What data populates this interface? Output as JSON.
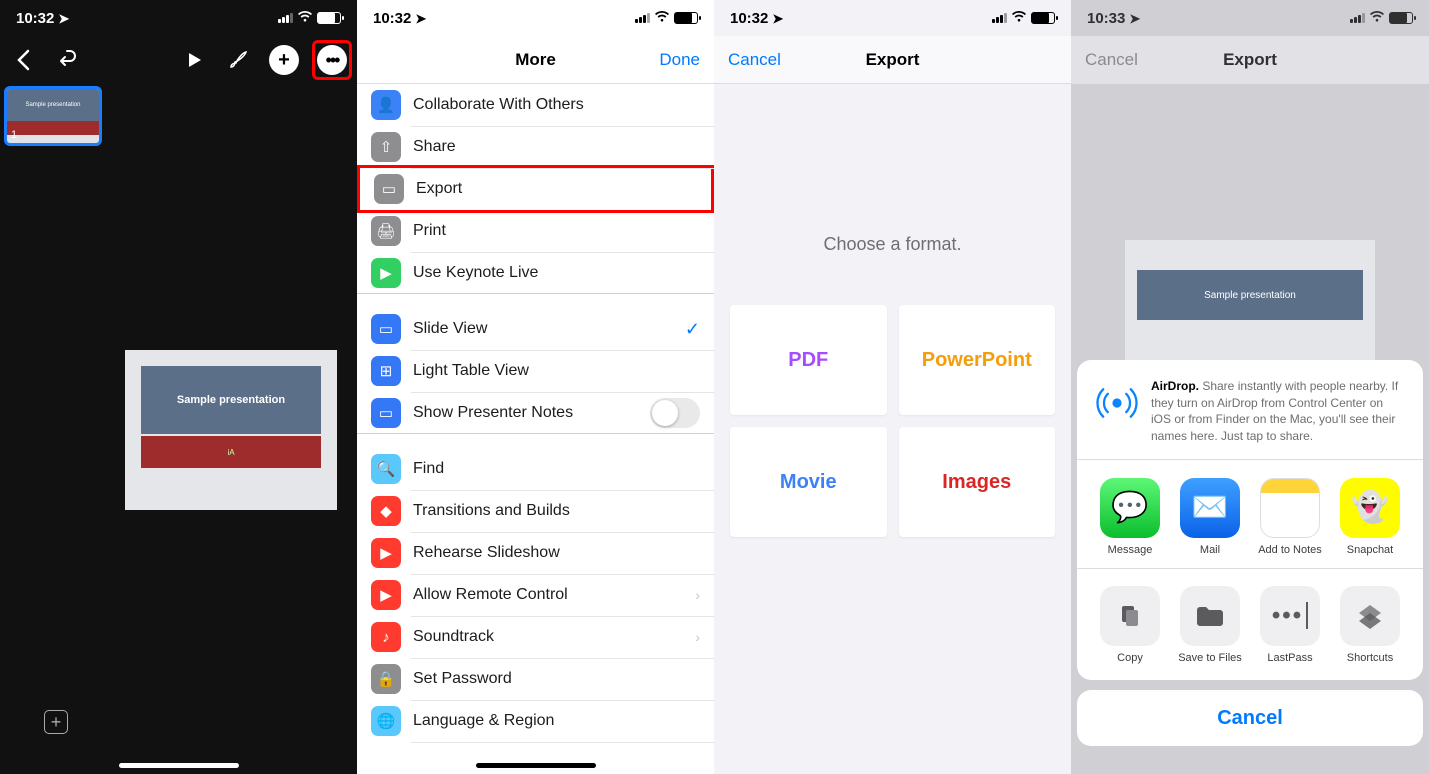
{
  "screen1": {
    "time": "10:32",
    "slide_number": "1",
    "slide_title": "Sample presentation",
    "slide_sub": "iA"
  },
  "screen2": {
    "time": "10:32",
    "nav_title": "More",
    "done": "Done",
    "items": {
      "collaborate": "Collaborate With Others",
      "share": "Share",
      "export": "Export",
      "print": "Print",
      "keynote_live": "Use Keynote Live",
      "slide_view": "Slide View",
      "light_table": "Light Table View",
      "presenter_notes": "Show Presenter Notes",
      "find": "Find",
      "transitions": "Transitions and Builds",
      "rehearse": "Rehearse Slideshow",
      "remote": "Allow Remote Control",
      "soundtrack": "Soundtrack",
      "password": "Set Password",
      "language": "Language & Region"
    }
  },
  "screen3": {
    "time": "10:32",
    "cancel": "Cancel",
    "title": "Export",
    "prompt": "Choose a format.",
    "formats": {
      "pdf": "PDF",
      "ppt": "PowerPoint",
      "movie": "Movie",
      "images": "Images"
    }
  },
  "screen4": {
    "time": "10:33",
    "cancel": "Cancel",
    "title": "Export",
    "airdrop_bold": "AirDrop.",
    "airdrop_text": " Share instantly with people nearby. If they turn on AirDrop from Control Center on iOS or from Finder on the Mac, you'll see their names here. Just tap to share.",
    "apps": {
      "message": "Message",
      "mail": "Mail",
      "notes": "Add to Notes",
      "snap": "Snapchat"
    },
    "actions": {
      "copy": "Copy",
      "files": "Save to Files",
      "lastpass": "LastPass",
      "shortcuts": "Shortcuts"
    },
    "sheet_cancel": "Cancel",
    "preview_title": "Sample presentation"
  }
}
